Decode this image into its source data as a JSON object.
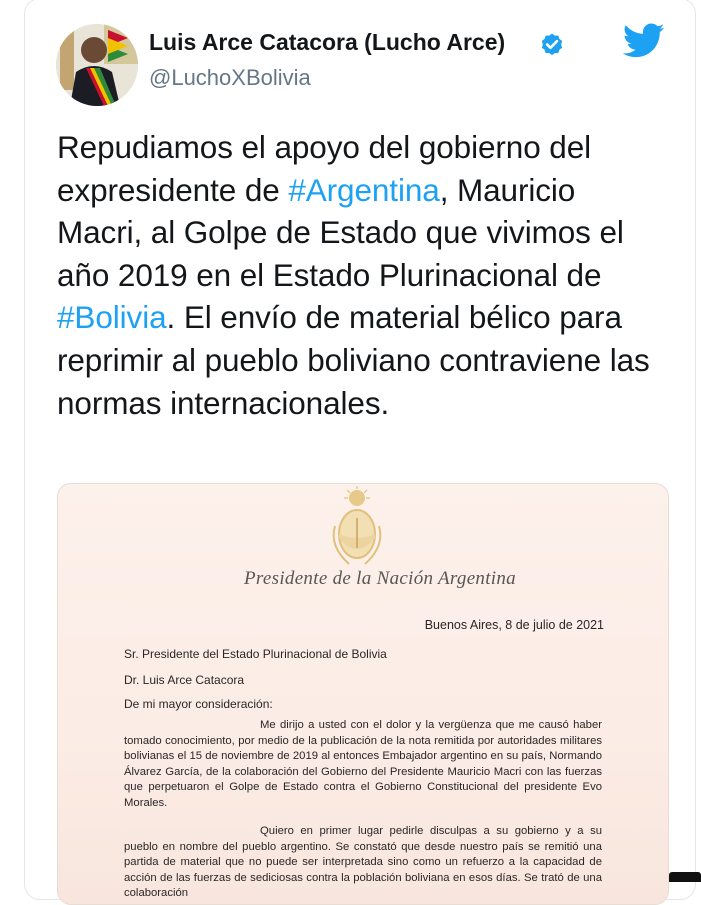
{
  "author": {
    "name": "Luis Arce Catacora (Lucho Arce)",
    "handle": "@LuchoXBolivia"
  },
  "icons": {
    "verified": "verified-badge-icon",
    "brand": "twitter-bird-icon",
    "brand_color": "#1da1f2"
  },
  "tweet": {
    "seg1": "Repudiamos el apoyo del gobierno del expresidente de ",
    "tag1": "#Argentina",
    "seg2": ", Mauricio Macri, al Golpe de Estado que vivimos el año 2019 en el Estado Plurinacional de ",
    "tag2": "#Bolivia",
    "seg3": ". El envío de material bélico para reprimir al pueblo boliviano contraviene las normas internacionales."
  },
  "letter": {
    "letterhead": "Presidente de la Nación Argentina",
    "date": "Buenos Aires, 8 de julio de 2021",
    "recipient": "Sr. Presidente del Estado Plurinacional de Bolivia",
    "recipient_name": "Dr. Luis Arce Catacora",
    "salutation": "De mi mayor consideración:",
    "para1": "Me dirijo a usted con el dolor y la vergüenza que me causó haber tomado conocimiento, por medio de la publicación de la nota remitida por autoridades militares bolivianas el 15 de noviembre de 2019 al entonces Embajador argentino en su país, Normando Álvarez García, de la colaboración del Gobierno del Presidente Mauricio Macri con las fuerzas que perpetuaron el Golpe de Estado contra el Gobierno Constitucional del presidente Evo Morales.",
    "para2": "Quiero en primer lugar pedirle disculpas a su gobierno y a su pueblo en nombre del pueblo argentino. Se constató que desde nuestro país se remitió una partida de material que no puede ser interpretada sino como un refuerzo a la capacidad de acción de las fuerzas de sediciosas contra la población boliviana en esos días. Se trató de una colaboración"
  }
}
